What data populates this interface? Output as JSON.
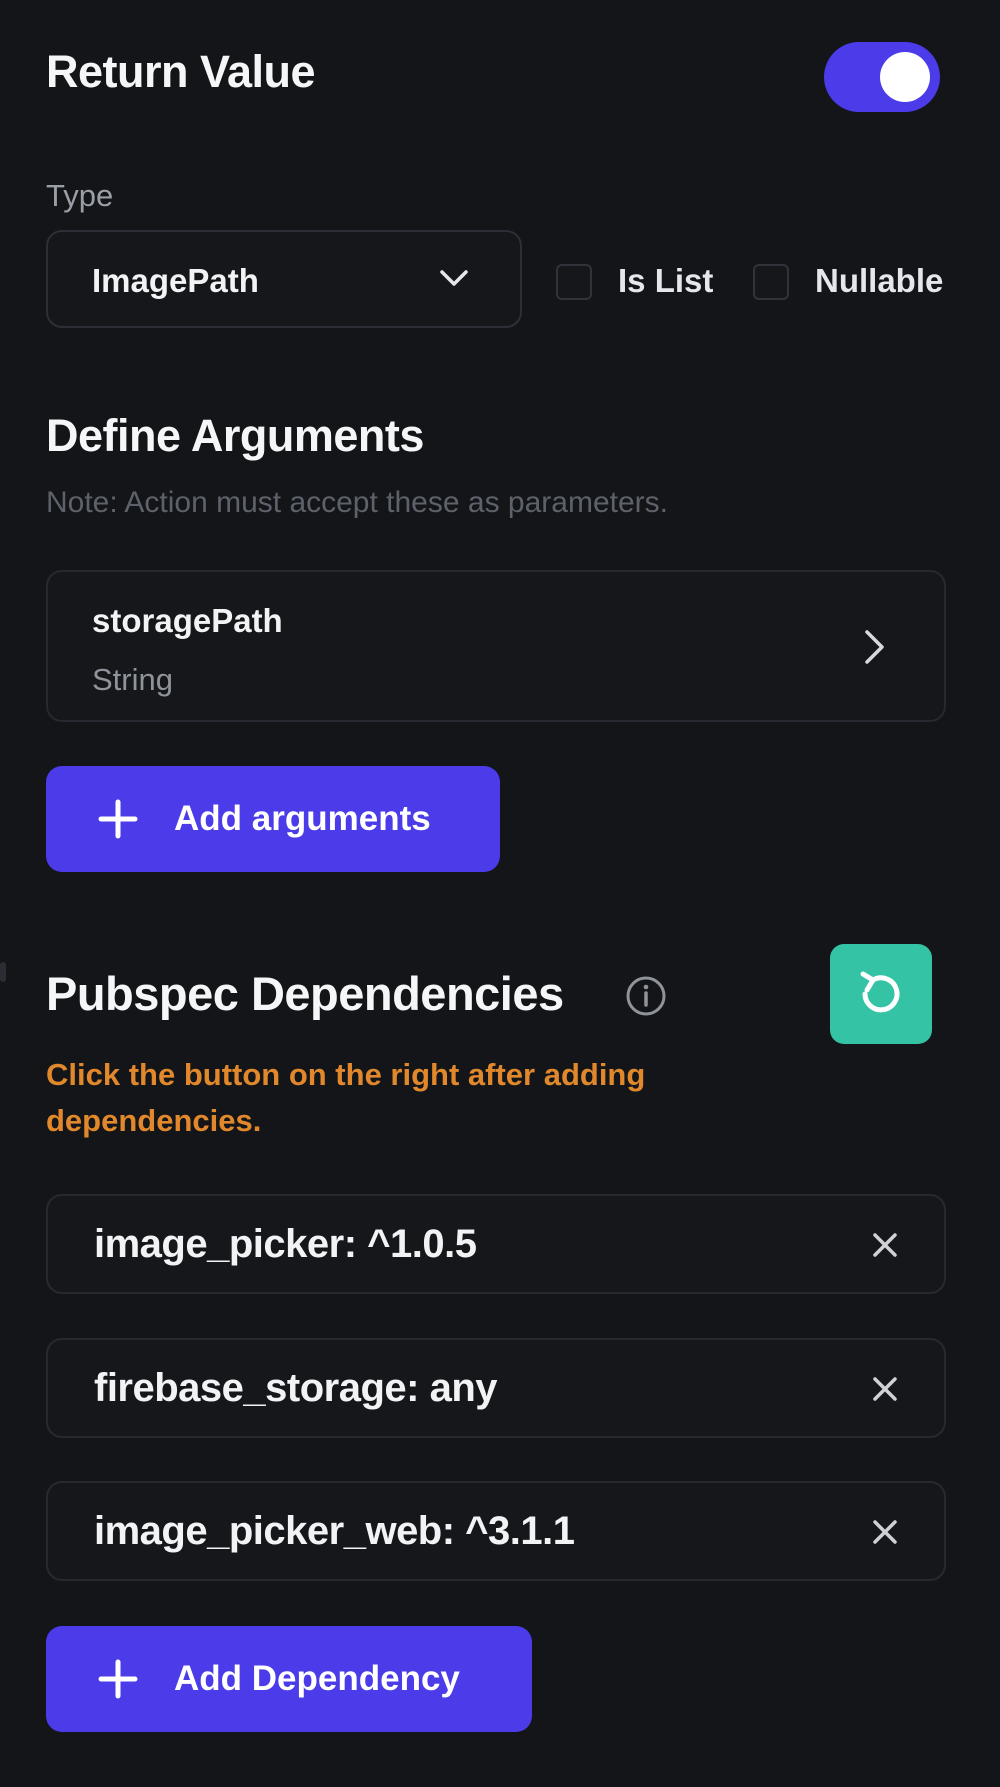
{
  "return_value": {
    "title": "Return Value",
    "toggle_on": true,
    "type_label": "Type",
    "type_value": "ImagePath",
    "is_list_label": "Is List",
    "is_list_checked": false,
    "nullable_label": "Nullable",
    "nullable_checked": false
  },
  "arguments": {
    "title": "Define Arguments",
    "note": "Note: Action must accept these as parameters.",
    "items": [
      {
        "name": "storagePath",
        "type": "String"
      }
    ],
    "add_label": "Add arguments"
  },
  "pubspec": {
    "title": "Pubspec Dependencies",
    "warning": "Click the button on the right after adding dependencies.",
    "dependencies": [
      "image_picker: ^1.0.5",
      "firebase_storage: any",
      "image_picker_web: ^3.1.1"
    ],
    "add_label": "Add Dependency"
  },
  "colors": {
    "background": "#131518",
    "accent": "#4b3be8",
    "refresh_button": "#35c3a6",
    "warning_text": "#e0882b"
  },
  "icons": [
    "chevron-down-icon",
    "chevron-right-icon",
    "plus-icon",
    "info-icon",
    "refresh-icon",
    "close-icon"
  ]
}
